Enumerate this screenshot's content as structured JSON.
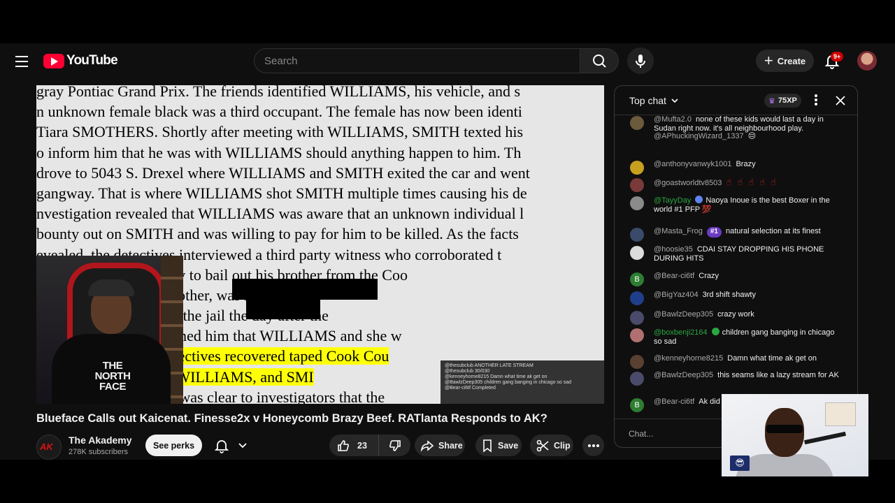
{
  "header": {
    "logo_text": "YouTube",
    "search_placeholder": "Search",
    "create_label": "Create",
    "notifications_badge": "9+"
  },
  "video": {
    "title": "Blueface Calls out Kaicenat. Finesse2x v Honeycomb Brazy Beef. RATlanta Responds to AK?",
    "document_lines": [
      "gray Pontiac Grand Prix.  The friends identified WILLIAMS, his vehicle, and s",
      "n unknown female black was a third occupant. The female has now been identi",
      "Tiara SMOTHERS.  Shortly after meeting with WILLIAMS, SMITH texted his",
      "o inform him that he was with WILLIAMS should anything happen to him.  Th",
      "drove to 5043 S. Drexel where WILLIAMS and SMITH exited the car and went",
      "gangway. That is where WILLIAMS shot SMITH multiple times causing his de",
      "nvestigation revealed that WILLIAMS was aware that an unknown individual l",
      "bounty out on SMITH and was willing to pay for him to be killed.   As the facts",
      "evealed, the detectives interviewed a third party witness who corroborated t",
      "AMS needed the money to bail out his brother from the Coo",
      "ed that                               WILLIAMS' brother, was incar",
      "med that                  bonded out of the jail the day after the",
      "hat SMOTHERS informed him that WILLIAMS and she w",
      "urder.  Additionally, detectives recovered taped Cook Cou",
      "that occurred between WILLIAMS,                  and SMI",
      "o \"talk in Code\", but it was clear to investigators that the"
    ],
    "webcam_shirt_text": "THE NORTH FACE",
    "overlay_chat_lines": [
      "@thesubclub  ANOTHER LATE STREAM",
      "@thesubclub  30/030",
      "@kenneyhorne8215  Damn what time ak get on",
      "@BawlzDeep305  children gang banging in chicago so sad",
      "@Bear-ci6tf  Completed"
    ]
  },
  "channel": {
    "name": "The Akademy",
    "subscribers": "278K subscribers",
    "avatar_text": "AK",
    "perks_label": "See perks"
  },
  "actions": {
    "likes": "23",
    "share_label": "Share",
    "save_label": "Save",
    "clip_label": "Clip"
  },
  "chat": {
    "mode_label": "Top chat",
    "xp_label": "75XP",
    "input_placeholder": "Chat...",
    "messages": [
      {
        "author": "@Mufta2.0",
        "text": "none of these kids would last a day in Sudan right now. it's all neighbourhood play.",
        "avatar": "#6b5a3c"
      },
      {
        "author": "@APhuckingWizard_1337",
        "text": "😔",
        "avatar": ""
      },
      {
        "author": "@anthonyvanwyk1001",
        "text": "Brazy",
        "avatar": "#c7a020"
      },
      {
        "author": "@goastworldtv8503",
        "text": "☝☝☝☝☝",
        "avatar": "#7a3a3a"
      },
      {
        "author": "@TayyDay",
        "text": "Naoya Inoue is the best Boxer in the world #1 PFP 💯",
        "avatar": "#8a8a8a"
      },
      {
        "author": "@Masta_Frog",
        "text": "natural selection at its finest",
        "member": "#1",
        "avatar": "#3a4a6a"
      },
      {
        "author": "@hoosie35",
        "text": "CDAI STAY DROPPING HIS PHONE DURING HITS",
        "avatar": "#dcdcdc"
      },
      {
        "author": "@Bear-ci6tf",
        "text": "Crazy",
        "avatar": "#2e7d32",
        "initial": "B"
      },
      {
        "author": "@BigYaz404",
        "text": "3rd shift shawty",
        "avatar": "#1f3f8a"
      },
      {
        "author": "@BawlzDeep305",
        "text": "crazy work",
        "avatar": "#4a4a6a"
      },
      {
        "author": "@boxbenji2164",
        "text": "children gang banging in chicago so sad",
        "avatar": "#b07070"
      },
      {
        "author": "@kenneyhorne8215",
        "text": "Damn what time ak get on",
        "avatar": "#5a4030"
      },
      {
        "author": "@BawlzDeep305",
        "text": "this seams like a lazy stream for AK",
        "avatar": "#4a4a6a"
      },
      {
        "author": "@Bear-ci6tf",
        "text": "Ak did",
        "avatar": "#2e7d32",
        "initial": "B"
      }
    ]
  },
  "pip": {
    "emoji": "😎"
  }
}
